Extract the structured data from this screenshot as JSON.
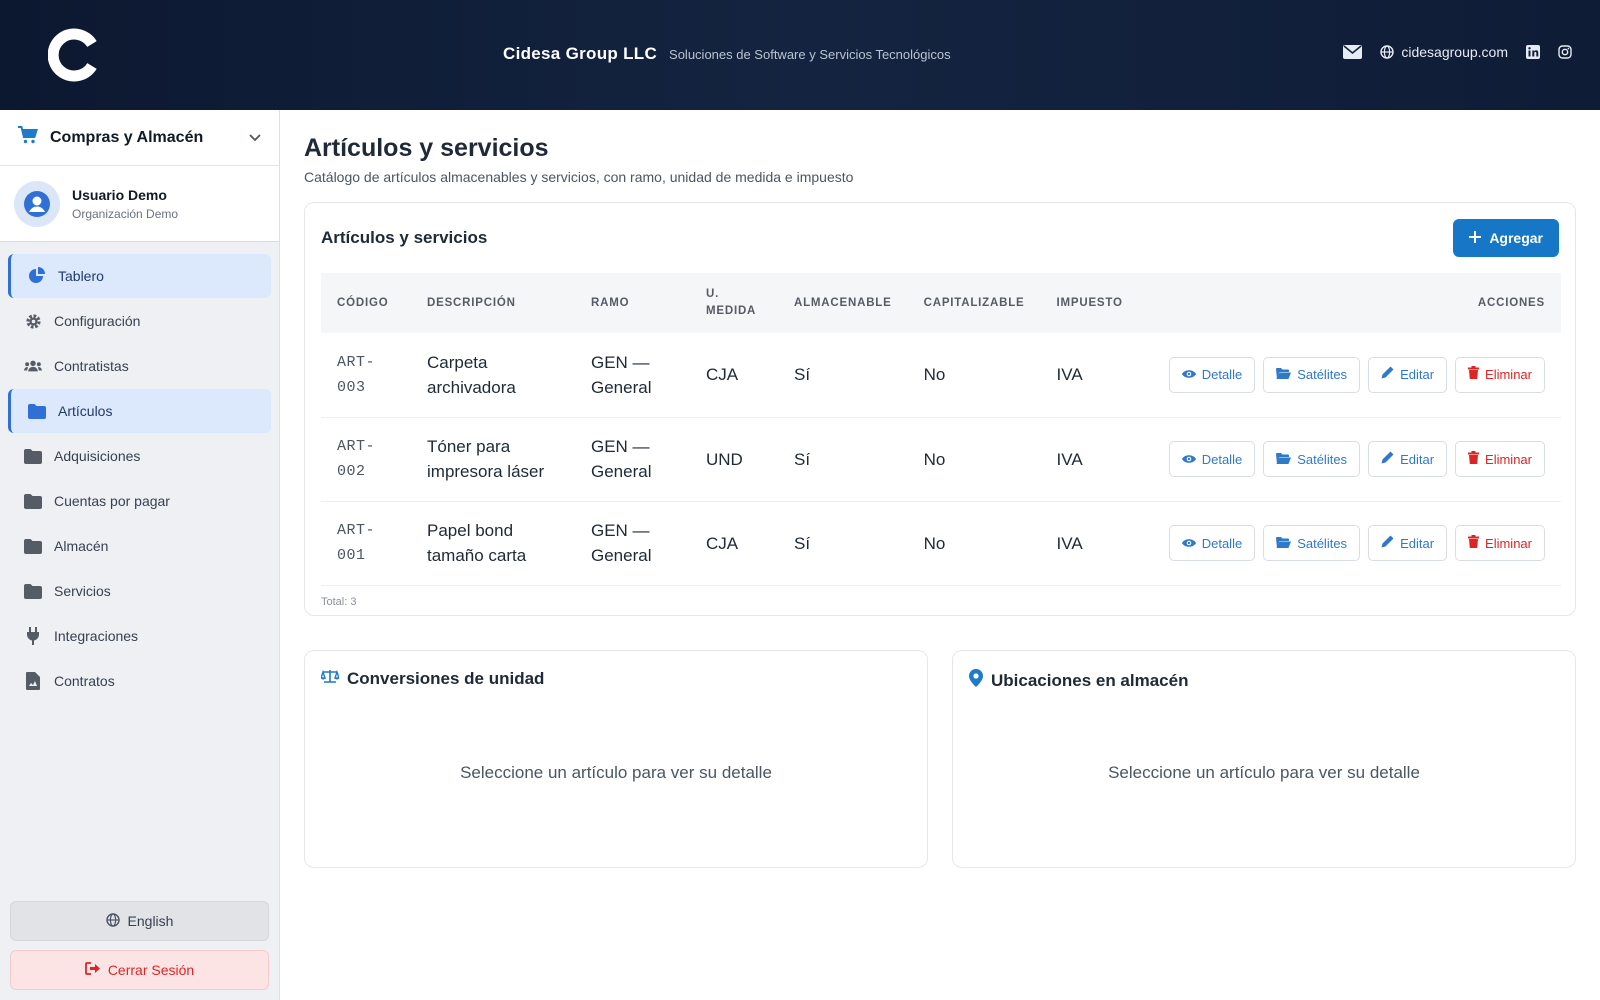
{
  "header": {
    "brand_name": "Cidesa Group LLC",
    "brand_tagline": "Soluciones de Software y Servicios Tecnológicos",
    "website": "cidesagroup.com",
    "icons": [
      "mail-icon",
      "globe-icon",
      "linkedin-icon",
      "instagram-icon"
    ]
  },
  "sidebar": {
    "module": "Compras y Almacén",
    "user": {
      "name": "Usuario Demo",
      "org": "Organización Demo"
    },
    "items": [
      {
        "label": "Tablero",
        "icon": "chart-pie-icon",
        "active": true
      },
      {
        "label": "Configuración",
        "icon": "gear-icon",
        "active": false
      },
      {
        "label": "Contratistas",
        "icon": "users-icon",
        "active": false
      },
      {
        "label": "Artículos",
        "icon": "folder-icon",
        "active": true
      },
      {
        "label": "Adquisiciones",
        "icon": "folder-icon",
        "active": false
      },
      {
        "label": "Cuentas por pagar",
        "icon": "folder-icon",
        "active": false
      },
      {
        "label": "Almacén",
        "icon": "folder-icon",
        "active": false
      },
      {
        "label": "Servicios",
        "icon": "folder-icon",
        "active": false
      },
      {
        "label": "Integraciones",
        "icon": "plug-icon",
        "active": false
      },
      {
        "label": "Contratos",
        "icon": "document-icon",
        "active": false
      }
    ],
    "language_button": "English",
    "logout_button": "Cerrar Sesión"
  },
  "main": {
    "title": "Artículos y servicios",
    "subtitle": "Catálogo de artículos almacenables y servicios, con ramo, unidad de medida e impuesto",
    "card": {
      "title": "Artículos y servicios",
      "add_button": "Agregar",
      "columns": [
        "CÓDIGO",
        "DESCRIPCIÓN",
        "RAMO",
        "U. MEDIDA",
        "ALMACENABLE",
        "CAPITALIZABLE",
        "IMPUESTO",
        "ACCIONES"
      ],
      "rows": [
        {
          "code": "ART-\n003",
          "description": "Carpeta archivadora",
          "ramo": "GEN — General",
          "unit": "CJA",
          "storable": "Sí",
          "capitalizable": "No",
          "tax": "IVA"
        },
        {
          "code": "ART-\n002",
          "description": "Tóner para impresora láser",
          "ramo": "GEN — General",
          "unit": "UND",
          "storable": "Sí",
          "capitalizable": "No",
          "tax": "IVA"
        },
        {
          "code": "ART-\n001",
          "description": "Papel bond tamaño carta",
          "ramo": "GEN — General",
          "unit": "CJA",
          "storable": "Sí",
          "capitalizable": "No",
          "tax": "IVA"
        }
      ],
      "row_actions": {
        "detail": "Detalle",
        "satellites": "Satélites",
        "edit": "Editar",
        "delete": "Eliminar"
      },
      "total": "Total: 3"
    },
    "conversions": {
      "title": "Conversiones de unidad",
      "empty": "Seleccione un artículo para ver su detalle"
    },
    "locations": {
      "title": "Ubicaciones en almacén",
      "empty": "Seleccione un artículo para ver su detalle"
    }
  },
  "colors": {
    "accent": "#1677c7",
    "danger": "#dc2626",
    "header_bg": "#0f1c36",
    "active_nav": "#dce8fb"
  }
}
